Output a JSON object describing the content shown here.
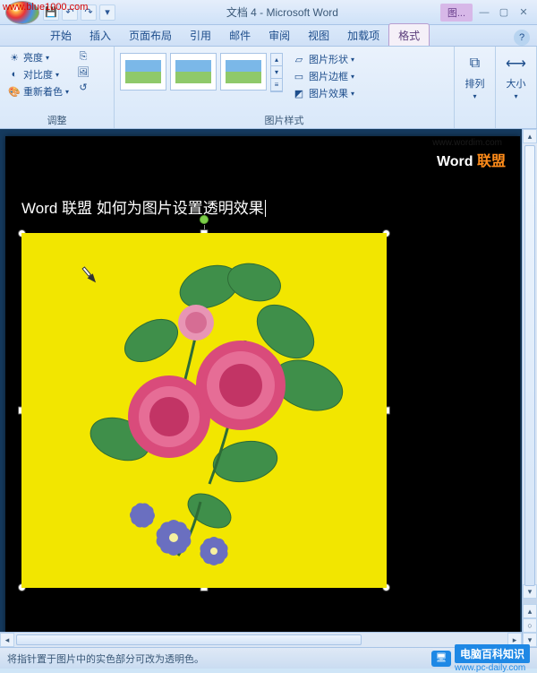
{
  "watermark": "www.blue1000.com",
  "title": "文档 4 - Microsoft Word",
  "context_tab_group": "图...",
  "qat_items": [
    "save",
    "undo",
    "redo",
    "ext"
  ],
  "tabs": {
    "items": [
      "开始",
      "插入",
      "页面布局",
      "引用",
      "邮件",
      "审阅",
      "视图",
      "加载项",
      "格式"
    ],
    "active_index": 8
  },
  "ribbon": {
    "adjust": {
      "brightness": "亮度",
      "contrast": "对比度",
      "recolor": "重新着色",
      "label": "调整"
    },
    "styles": {
      "shape": "图片形状",
      "border": "图片边框",
      "effects": "图片效果",
      "label": "图片样式"
    },
    "arrange": {
      "label": "排列"
    },
    "size": {
      "label": "大小"
    }
  },
  "document": {
    "wordim": "www.wordim.com",
    "brand_word": "Word",
    "brand_union": "联盟",
    "heading": "Word 联盟  如何为图片设置透明效果"
  },
  "statusbar": {
    "hint": "将指针置于图片中的实色部分可改为透明色。"
  },
  "footer_brand": {
    "text": "电脑百科知识",
    "url": "www.pc-daily.com"
  }
}
